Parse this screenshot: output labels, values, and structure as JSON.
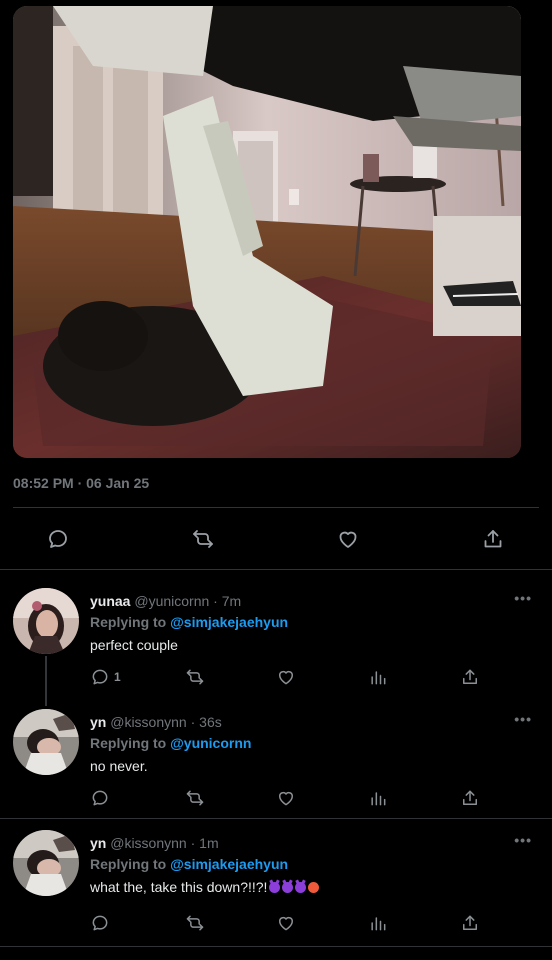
{
  "tweet": {
    "timestamp": "08:52 PM · 06 Jan 25"
  },
  "main_actions": {
    "icons": [
      "reply-icon",
      "retweet-icon",
      "like-icon",
      "share-icon"
    ]
  },
  "replies": [
    {
      "name": "yunaa",
      "handle": "@yunicornn",
      "time": "7m",
      "replying_prefix": "Replying to",
      "replying_to": "@simjakejaehyun",
      "text": "perfect couple",
      "reply_count": "1",
      "more": "•••"
    },
    {
      "name": "yn",
      "handle": "@kissonynn",
      "time": "36s",
      "replying_prefix": "Replying to",
      "replying_to": "@yunicornn",
      "text": "no never.",
      "reply_count": "",
      "more": "•••"
    },
    {
      "name": "yn",
      "handle": "@kissonynn",
      "time": "1m",
      "replying_prefix": "Replying to",
      "replying_to": "@simjakejaehyun",
      "text": "what the, take this down?!!?!",
      "emojis": [
        "smiling-imp-emoji",
        "smiling-imp-emoji",
        "smiling-imp-emoji",
        "angry-face-emoji"
      ],
      "reply_count": "",
      "more": "•••"
    }
  ],
  "colors": {
    "background": "#000000",
    "mention": "#1d9bf0",
    "muted": "#71767b",
    "divider": "#2f3336"
  }
}
